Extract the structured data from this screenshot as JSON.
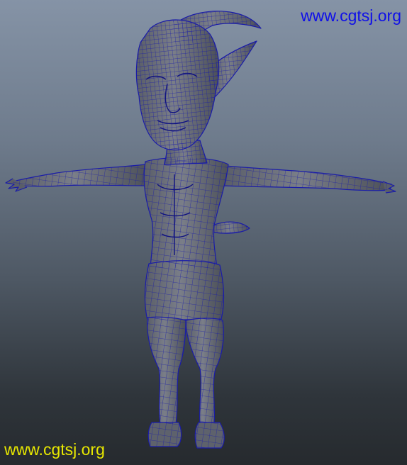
{
  "viewport": {
    "background_top": "#8593a6",
    "background_bottom": "#262a2e",
    "mesh_fill": "#6c7078",
    "mesh_shadow": "#4a4e56",
    "wire_color": "#1a1ca8"
  },
  "model": {
    "icon": "demon-character-wireframe-mesh"
  },
  "watermarks": {
    "top": {
      "text": "www.cgtsj.org",
      "color": "#1010e8"
    },
    "bottom": {
      "text": "www.cgtsj.org",
      "color": "#e8e800"
    }
  }
}
